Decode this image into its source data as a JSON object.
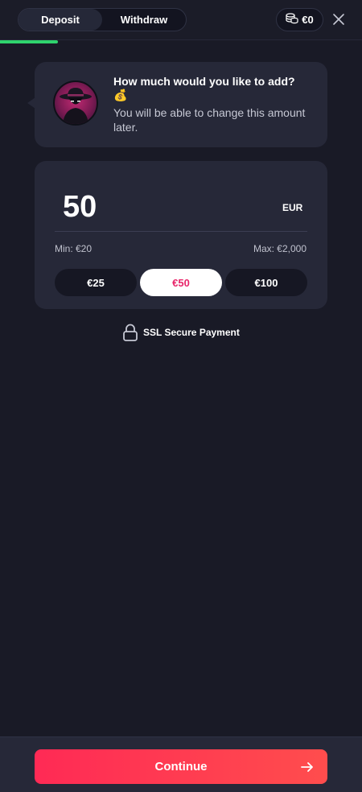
{
  "tabs": [
    {
      "label": "Deposit",
      "active": true
    },
    {
      "label": "Withdraw",
      "active": false
    }
  ],
  "balance": {
    "amount": "€0",
    "icon": "coins-icon"
  },
  "progress": {
    "fraction": 0.16
  },
  "prompt": {
    "title": "How much would you like to add? 💰",
    "subtitle": "You will be able to change this amount later."
  },
  "amount": {
    "value": "50",
    "currency": "EUR",
    "min_label": "Min: €20",
    "max_label": "Max: €2,000"
  },
  "presets": [
    {
      "label": "€25",
      "selected": false
    },
    {
      "label": "€50",
      "selected": true
    },
    {
      "label": "€100",
      "selected": false
    }
  ],
  "secure_label": "SSL Secure Payment",
  "continue_label": "Continue",
  "colors": {
    "background": "#191a26",
    "card": "#262838",
    "accent": "#ff2a55",
    "progress": "#2fd36d",
    "selected_text": "#e8266a"
  }
}
